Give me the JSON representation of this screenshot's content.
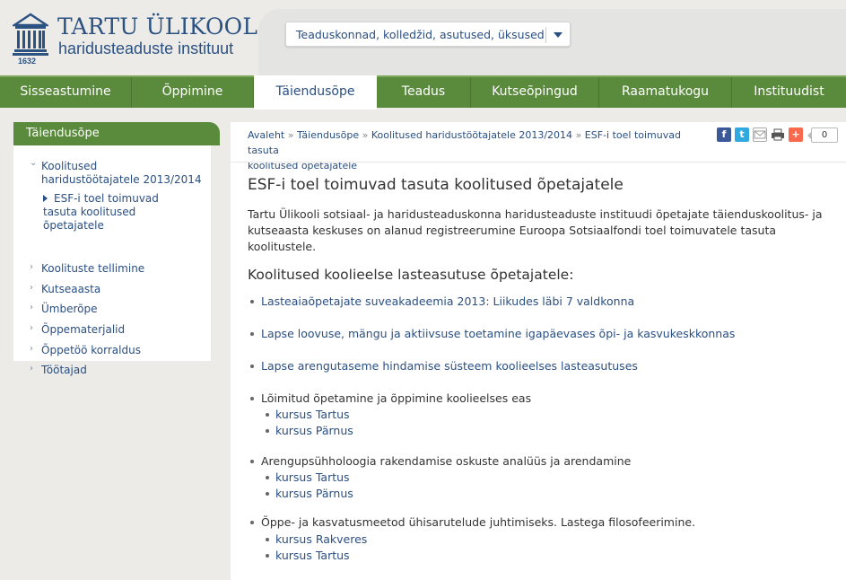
{
  "header": {
    "logo_title": "TARTU ÜLIKOOL",
    "logo_subtitle": "haridusteaduste instituut",
    "logo_year": "1632",
    "dropdown_label": "Teaduskonnad, kolledžid, asutused, üksused"
  },
  "nav": [
    "Sisseastumine",
    "Õppimine",
    "Täiendusõpe",
    "Teadus",
    "Kutseõpingud",
    "Raamatukogu",
    "Instituudist"
  ],
  "sidebar": {
    "title": "Täiendusõpe",
    "expanded_label": "Koolitused haridustöötajatele 2013/2014",
    "expanded_line1": "Koolitused",
    "expanded_line2": "haridustöötajatele 2013/2014",
    "active_line1": "ESF-i toel toimuvad",
    "active_line2": "tasuta koolitused",
    "active_line3": "õpetajatele",
    "items": [
      "Koolituste tellimine",
      "Kutseaasta",
      "Ümberõpe",
      "Õppematerjalid",
      "Õppetöö korraldus",
      "Töötajad"
    ]
  },
  "breadcrumb": {
    "c1": "Avaleht",
    "c2": "Täiendusõpe",
    "c3": "Koolitused haridustöötajatele 2013/2014",
    "c4a": "ESF-i toel toimuvad tasuta",
    "c4b": "koolitused õpetajatele",
    "sep": "»"
  },
  "share": {
    "counter": "0",
    "facebook": "f",
    "twitter": "t",
    "plus": "+"
  },
  "main": {
    "title": "ESF-i toel toimuvad tasuta koolitused õpetajatele",
    "intro_l1": "Tartu Ülikooli sotsiaal- ja haridusteaduskonna haridusteaduste instituudi õpetajate täienduskoolitus- ja",
    "intro_l2": "kutseaasta keskuses  on alanud registreerumine Euroopa Sotsiaalfondi toel toimuvatele tasuta",
    "intro_l3": "koolitustele.",
    "section_title": "Koolitused koolieelse lasteasutuse õpetajatele:",
    "link1": "Lasteaiaõpetajate suveakadeemia 2013: Liikudes läbi 7 valdkonna",
    "link2": "Lapse loovuse, mängu ja aktiivsuse toetamine igapäevases õpi- ja kasvukeskkonnas",
    "link3": "Lapse arengutaseme hindamise süsteem koolieelses lasteasutuses",
    "group1_title": "Lõimitud õpetamine ja õppimine koolieelses eas",
    "group1_a": "kursus Tartus",
    "group1_b": "kursus Pärnus",
    "group2_title": "Arengupsühholoogia rakendamise oskuste analüüs ja arendamine",
    "group2_a": "kursus Tartus",
    "group2_b": "kursus Pärnus",
    "group3_title": "Õppe- ja kasvatusmeetod ühisarutelude juhtimiseks. Lastega filosofeerimine.",
    "group3_a": "kursus Rakveres",
    "group3_b": "kursus Tartus"
  },
  "colors": {
    "brand_blue": "#2a4f82",
    "nav_green": "#5a8a3b",
    "background": "#ecebe8"
  }
}
